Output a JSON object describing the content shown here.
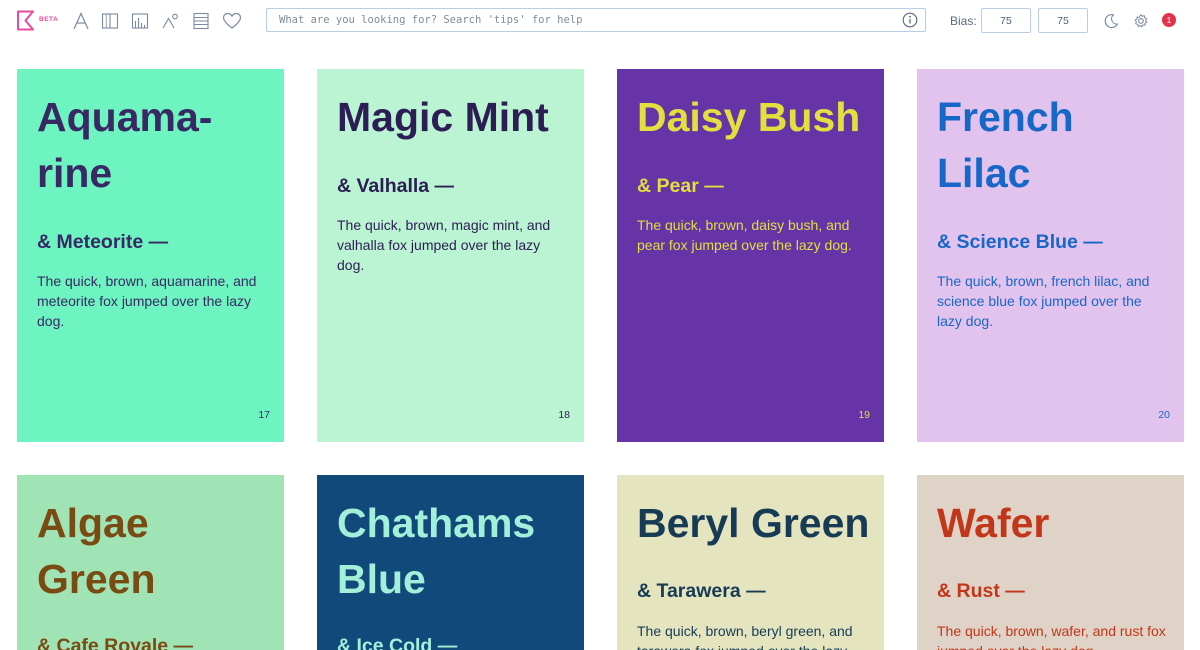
{
  "toolbar": {
    "beta_label": "BETA",
    "search_placeholder": "What are you looking for? Search 'tips' for help",
    "bias_label": "Bias:",
    "bias_value_1": "75",
    "bias_value_2": "75",
    "notification_count": "1",
    "icons": [
      "logo-icon",
      "font-icon",
      "layout-columns-icon",
      "bar-chart-icon",
      "shapes-icon",
      "list-icon",
      "heart-icon",
      "info-icon",
      "moon-icon",
      "gear-icon"
    ],
    "icon_color": "#7a8aa2",
    "accent": "#e64b9c"
  },
  "cards": [
    {
      "name": "Aquama-rine",
      "name_lines": [
        "Aquama-",
        "rine"
      ],
      "pair": "& Meteorite —",
      "text": "The quick, brown, aquamarine, and meteorite fox jumped over the lazy dog.",
      "num": "17",
      "bg": "#6df4c0",
      "fg": "#382964"
    },
    {
      "name": "Magic Mint",
      "name_lines": [
        "Magic Mint"
      ],
      "pair": "& Valhalla —",
      "text": "The quick, brown, magic mint, and valhalla fox jumped over the lazy dog.",
      "num": "18",
      "bg": "#bbf4d2",
      "fg": "#2c1d55"
    },
    {
      "name": "Daisy Bush",
      "name_lines": [
        "Daisy Bush"
      ],
      "pair": "& Pear —",
      "text": "The quick, brown, daisy bush, and pear fox jumped over the lazy dog.",
      "num": "19",
      "bg": "#6634a6",
      "fg": "#e2df3e"
    },
    {
      "name": "French Lilac",
      "name_lines": [
        "French",
        "Lilac"
      ],
      "pair": "& Science Blue —",
      "text": "The quick, brown, french lilac, and science blue fox jumped over the lazy dog.",
      "num": "20",
      "bg": "#e2c3ee",
      "fg": "#1767c8"
    },
    {
      "name": "Algae Green",
      "name_lines": [
        "Algae",
        "Green"
      ],
      "pair": "& Cafe Royale —",
      "text": "",
      "num": "",
      "bg": "#a0e3b5",
      "fg": "#7a4a13"
    },
    {
      "name": "Chathams Blue",
      "name_lines": [
        "Chathams",
        "Blue"
      ],
      "pair": "& Ice Cold —",
      "text": "",
      "num": "",
      "bg": "#12497b",
      "fg": "#a2f0d9"
    },
    {
      "name": "Beryl Green",
      "name_lines": [
        "Beryl Green"
      ],
      "pair": "& Tarawera —",
      "text": "The quick, brown, beryl green, and tarawera fox jumped over the lazy dog.",
      "num": "",
      "bg": "#e4e5bf",
      "fg": "#173b55"
    },
    {
      "name": "Wafer",
      "name_lines": [
        "Wafer"
      ],
      "pair": "& Rust —",
      "text": "The quick, brown, wafer, and rust fox jumped over the lazy dog.",
      "num": "",
      "bg": "#dfd2c6",
      "fg": "#c2361a"
    }
  ]
}
